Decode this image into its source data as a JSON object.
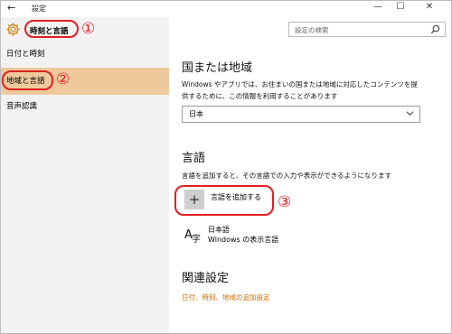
{
  "titlebar": {
    "title": "設定",
    "back_icon": "←",
    "min_icon": "—",
    "max_icon": "☐",
    "close_icon": "✕"
  },
  "sidebar": {
    "category_title": "時刻と言語",
    "items": [
      {
        "label": "日付と時刻",
        "selected": false
      },
      {
        "label": "地域と言語",
        "selected": true
      },
      {
        "label": "音声認識",
        "selected": false
      }
    ]
  },
  "search": {
    "placeholder": "設定の検索"
  },
  "annotations": [
    "①",
    "②",
    "③"
  ],
  "region": {
    "heading": "国または地域",
    "description_line1": "Windows やアプリでは、お住まいの国または地域に対応したコンテンツを提",
    "description_line2": "供するために、この情報を利用することがあります",
    "selected": "日本"
  },
  "language": {
    "heading": "言語",
    "description": "言語を追加すると、その言語での入力や表示ができるようになります",
    "add_label": "言語を追加する",
    "items": [
      {
        "name": "日本語",
        "sub": "Windows の表示言語"
      }
    ]
  },
  "related": {
    "heading": "関連設定",
    "link": "日付、時刻、地域の追加設定"
  },
  "colors": {
    "accent": "#d06e00",
    "selected_bg": "#edc99c",
    "annotation": "#e02020"
  }
}
